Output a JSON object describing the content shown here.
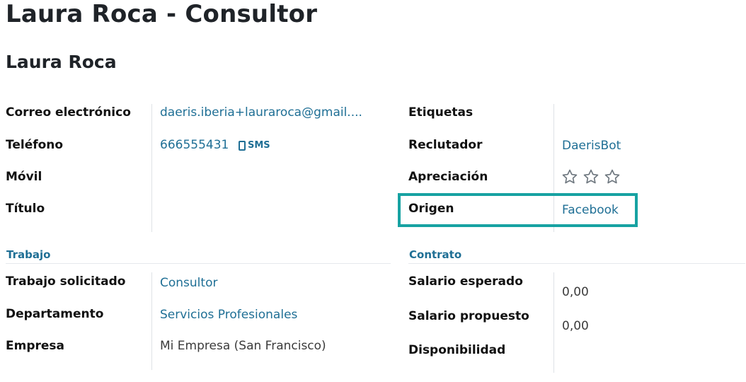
{
  "header": {
    "title": "Laura Roca - Consultor",
    "applicant_name": "Laura Roca"
  },
  "contact": {
    "email_label": "Correo electrónico",
    "email_value": "daeris.iberia+lauraroca@gmail....",
    "phone_label": "Teléfono",
    "phone_value": "666555431",
    "sms_label": "SMS",
    "mobile_label": "Móvil",
    "mobile_value": "",
    "degree_label": "Título",
    "degree_value": ""
  },
  "details": {
    "tags_label": "Etiquetas",
    "recruiter_label": "Reclutador",
    "recruiter_value": "DaerisBot",
    "rating_label": "Apreciación",
    "rating": {
      "filled": 0,
      "total": 3
    },
    "source_label": "Origen",
    "source_value": "Facebook"
  },
  "job": {
    "section_title": "Trabajo",
    "job_label": "Trabajo solicitado",
    "job_value": "Consultor",
    "department_label": "Departamento",
    "department_value": "Servicios Profesionales",
    "company_label": "Empresa",
    "company_value": "Mi Empresa (San Francisco)"
  },
  "contract": {
    "section_title": "Contrato",
    "expected_salary_label": "Salario esperado",
    "expected_salary_value": "0,00",
    "proposed_salary_label": "Salario propuesto",
    "proposed_salary_value": "0,00",
    "availability_label": "Disponibilidad",
    "availability_value": ""
  },
  "colors": {
    "link": "#1f6f95",
    "highlight": "#17a2a2",
    "text": "#111111"
  }
}
